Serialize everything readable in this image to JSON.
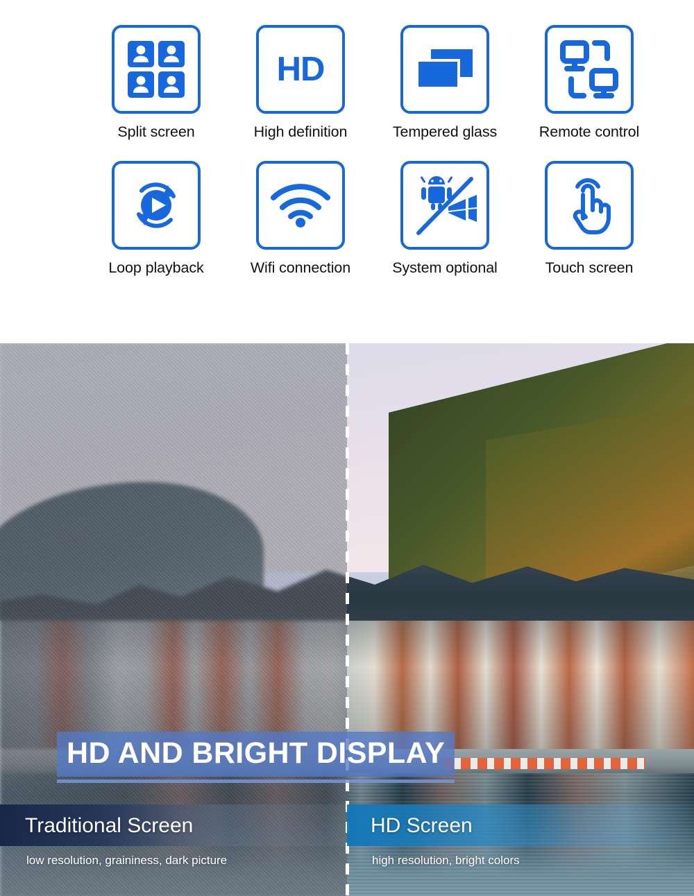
{
  "theme": {
    "accent_blue": "#1668DC",
    "headline_band": "#537AC7",
    "headline_rule": "#7896D7",
    "caption_left_band": "#162548",
    "caption_right_band": "#1076BA",
    "text_dark": "#111111",
    "white": "#FFFFFF"
  },
  "features": {
    "row1": [
      {
        "label": "Split screen",
        "icon": "split-screen-icon"
      },
      {
        "label": "High definition",
        "icon": "hd-icon"
      },
      {
        "label": "Tempered glass",
        "icon": "tempered-glass-icon"
      },
      {
        "label": "Remote control",
        "icon": "remote-control-icon"
      }
    ],
    "row2": [
      {
        "label": "Loop playback",
        "icon": "loop-playback-icon"
      },
      {
        "label": "Wifi connection",
        "icon": "wifi-icon"
      },
      {
        "label": "System optional",
        "icon": "system-optional-icon"
      },
      {
        "label": "Touch screen",
        "icon": "touch-screen-icon"
      }
    ]
  },
  "hero": {
    "headline": "HD AND BRIGHT DISPLAY",
    "divider": "dashed-vertical-divider",
    "left": {
      "title": "Traditional Screen",
      "subtitle": "low resolution, graininess, dark picture"
    },
    "right": {
      "title": "HD Screen",
      "subtitle": "high resolution, bright colors"
    }
  },
  "hd_icon_text": "HD"
}
